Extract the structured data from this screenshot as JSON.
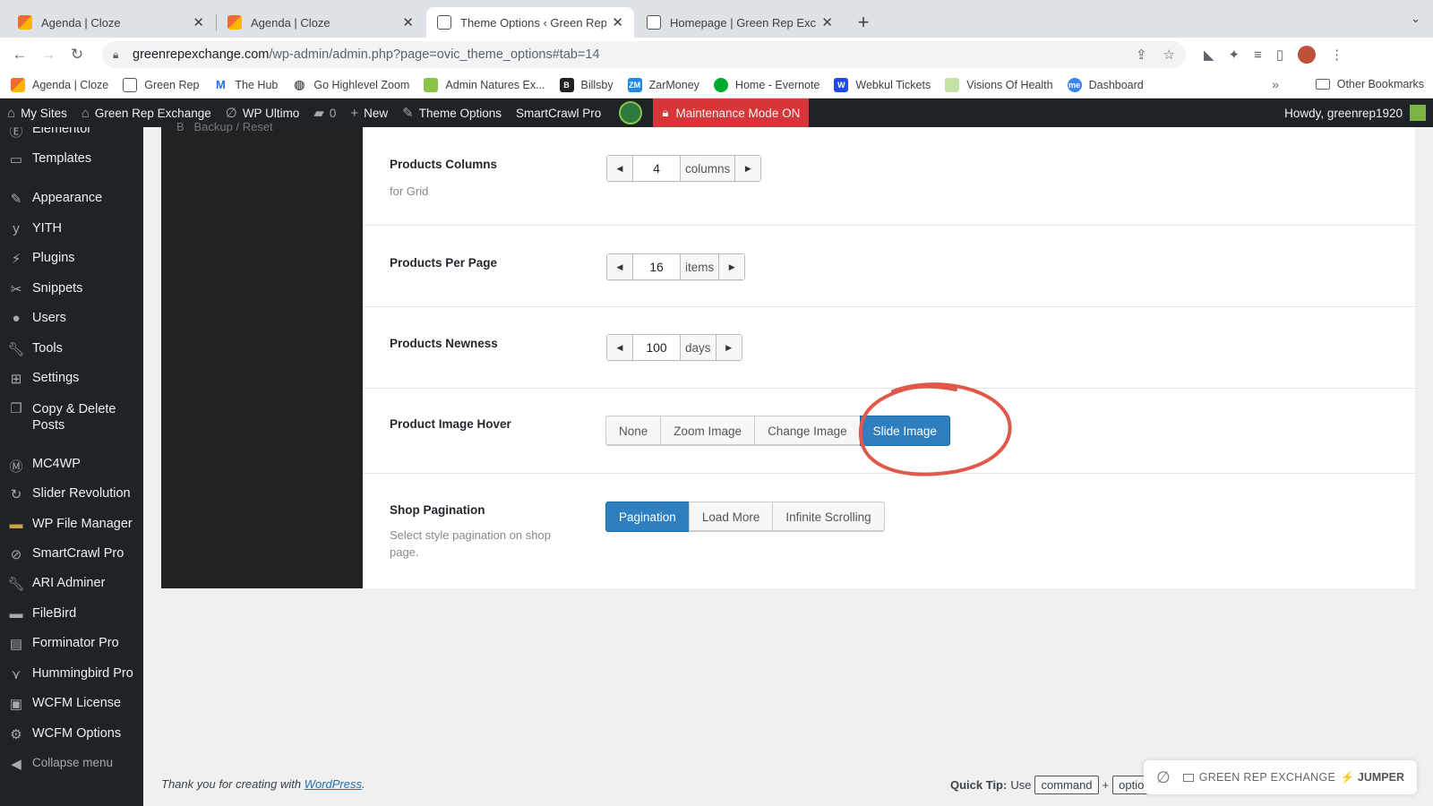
{
  "browser": {
    "tabs": [
      {
        "title": "Agenda | Cloze",
        "favicon": "cloze-icon",
        "active": false
      },
      {
        "title": "Agenda | Cloze",
        "favicon": "cloze-icon",
        "active": false
      },
      {
        "title": "Theme Options ‹ Green Rep Ex",
        "favicon": "greenrep-icon",
        "active": true
      },
      {
        "title": "Homepage | Green Rep Exchan",
        "favicon": "greenrep-icon",
        "active": false
      }
    ],
    "url_domain": "greenrepexchange.com",
    "url_path": "/wp-admin/admin.php?page=ovic_theme_options#tab=14",
    "bookmarks": [
      {
        "label": "Agenda | Cloze",
        "icon": "cloze-icon",
        "color": "#f06a35"
      },
      {
        "label": "Green Rep",
        "icon": "greenrep-icon",
        "color": "#555555"
      },
      {
        "label": "The Hub",
        "icon": "wpmudev-icon",
        "color": "#286ef1"
      },
      {
        "label": "Go Highlevel Zoom",
        "icon": "globe-icon",
        "color": "#5f6368"
      },
      {
        "label": "Admin Natures Ex...",
        "icon": "leaf-icon",
        "color": "#8bc34a"
      },
      {
        "label": "Billsby",
        "icon": "billsby-icon",
        "color": "#222222"
      },
      {
        "label": "ZarMoney",
        "icon": "zarmoney-icon",
        "color": "#1e88e5"
      },
      {
        "label": "Home - Evernote",
        "icon": "evernote-icon",
        "color": "#00a82d"
      },
      {
        "label": "Webkul Tickets",
        "icon": "webkul-icon",
        "color": "#2149f3"
      },
      {
        "label": "Visions Of Health",
        "icon": "leaf-icon",
        "color": "#9ccc65"
      },
      {
        "label": "Dashboard",
        "icon": "dashboard-icon",
        "color": "#3b82f6"
      }
    ],
    "bookmarks_more": "»",
    "other_bookmarks": "Other Bookmarks"
  },
  "adminbar": {
    "my_sites": "My Sites",
    "site_name": "Green Rep Exchange",
    "wp_ultimo": "WP Ultimo",
    "comments_count": "0",
    "new": "New",
    "theme_options": "Theme Options",
    "smartcrawl": "SmartCrawl Pro",
    "maintenance": "Maintenance Mode ON",
    "howdy": "Howdy, greenrep1920"
  },
  "menu": [
    {
      "label": "Elementor",
      "icon": "elementor-icon"
    },
    {
      "label": "Templates",
      "icon": "folder-icon"
    },
    {
      "label": "Appearance",
      "icon": "paintbrush-icon"
    },
    {
      "label": "YITH",
      "icon": "yith-icon"
    },
    {
      "label": "Plugins",
      "icon": "plug-icon"
    },
    {
      "label": "Snippets",
      "icon": "scissors-icon"
    },
    {
      "label": "Users",
      "icon": "user-icon"
    },
    {
      "label": "Tools",
      "icon": "wrench-icon"
    },
    {
      "label": "Settings",
      "icon": "sliders-icon"
    },
    {
      "label": "Copy & Delete Posts",
      "icon": "copy-icon"
    },
    {
      "label": "MC4WP",
      "icon": "mc4wp-icon"
    },
    {
      "label": "Slider Revolution",
      "icon": "refresh-icon"
    },
    {
      "label": "WP File Manager",
      "icon": "file-manager-icon"
    },
    {
      "label": "SmartCrawl Pro",
      "icon": "smartcrawl-icon"
    },
    {
      "label": "ARI Adminer",
      "icon": "wrench-icon"
    },
    {
      "label": "FileBird",
      "icon": "folder-icon"
    },
    {
      "label": "Forminator Pro",
      "icon": "clipboard-icon"
    },
    {
      "label": "Hummingbird Pro",
      "icon": "hummingbird-icon"
    },
    {
      "label": "WCFM License",
      "icon": "wcfm-icon"
    },
    {
      "label": "WCFM Options",
      "icon": "gear-icon"
    },
    {
      "label": "Collapse menu",
      "icon": "collapse-icon"
    }
  ],
  "subnav_truncated": "Backup / Reset",
  "options": {
    "products_columns": {
      "label": "Products Columns",
      "desc": "for Grid",
      "value": "4",
      "unit": "columns"
    },
    "products_per_page": {
      "label": "Products Per Page",
      "value": "16",
      "unit": "items"
    },
    "products_newness": {
      "label": "Products Newness",
      "value": "100",
      "unit": "days"
    },
    "image_hover": {
      "label": "Product Image Hover",
      "choices": [
        "None",
        "Zoom Image",
        "Change Image",
        "Slide Image"
      ],
      "selected": "Slide Image"
    },
    "shop_pagination": {
      "label": "Shop Pagination",
      "desc": "Select style pagination on shop page.",
      "choices": [
        "Pagination",
        "Load More",
        "Infinite Scrolling"
      ],
      "selected": "Pagination"
    }
  },
  "annotation_color": "#e0584a",
  "accent_color": "#2e7fc0",
  "footer": {
    "thanks_prefix": "Thank you for creating with ",
    "thanks_link": "WordPress",
    "thanks_suffix": ".",
    "quicktip_label": "Quick Tip:",
    "quicktip_text": "Use",
    "key1": "command",
    "plus": "+",
    "key2": "optio"
  },
  "jumper": {
    "site": "GREEN REP EXCHANGE",
    "label": "⚡ JUMPER"
  }
}
